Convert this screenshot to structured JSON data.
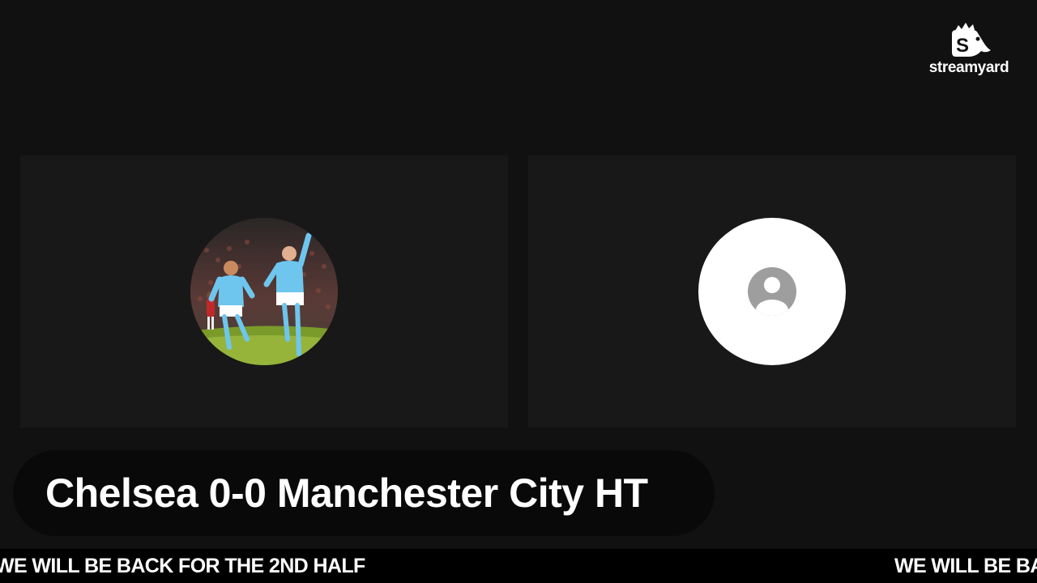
{
  "logo": {
    "text": "streamyard",
    "icon": "streamyard-logo-icon"
  },
  "tiles": [
    {
      "kind": "photo",
      "avatar": "football-players-photo"
    },
    {
      "kind": "placeholder",
      "avatar": "person-icon"
    }
  ],
  "banner": {
    "text": "Chelsea 0-0 Manchester City HT"
  },
  "ticker": {
    "text": "WE WILL BE BACK FOR THE 2ND HALF"
  },
  "colors": {
    "background": "#111111",
    "tile": "#181818",
    "banner": "#090909",
    "ticker": "#000000",
    "placeholder_avatar": "#ffffff",
    "person_icon": "#9e9e9e"
  }
}
